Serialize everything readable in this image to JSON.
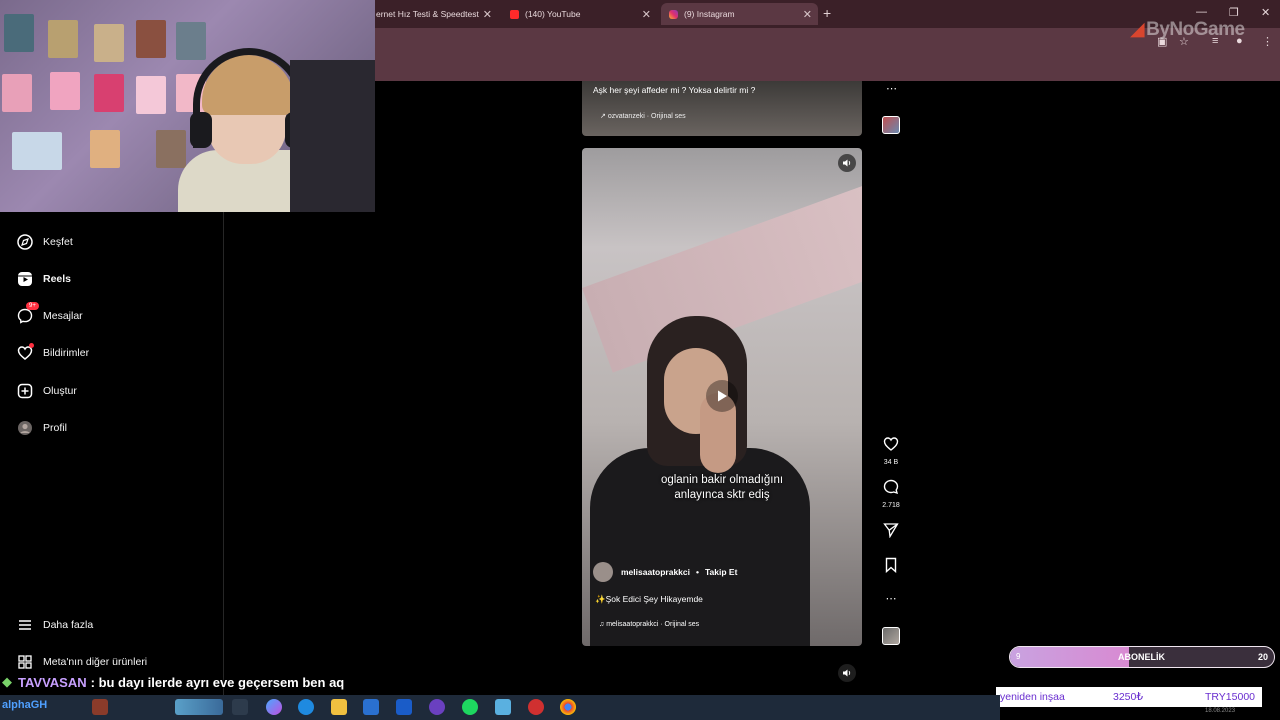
{
  "browser": {
    "tabs": [
      {
        "label": "ernet Hız Testi & Speedtest",
        "active": false
      },
      {
        "label": "(140) YouTube",
        "active": false
      },
      {
        "label": "(9) Instagram",
        "active": true
      }
    ],
    "new_tab": "+",
    "min": "—",
    "max": "❐",
    "close": "✕"
  },
  "watermark": {
    "text": "ByNoGame"
  },
  "sidebar": {
    "items": [
      {
        "label": "Keşfet",
        "icon": "compass-icon"
      },
      {
        "label": "Reels",
        "icon": "reels-icon"
      },
      {
        "label": "Mesajlar",
        "icon": "messenger-icon",
        "badge": "9+"
      },
      {
        "label": "Bildirimler",
        "icon": "heart-icon"
      },
      {
        "label": "Oluştur",
        "icon": "plus-square-icon"
      },
      {
        "label": "Profil",
        "icon": "avatar-icon"
      }
    ],
    "more": "Daha fazla",
    "meta": "Meta'nın diğer ürünleri"
  },
  "reel_top": {
    "caption": "Aşk her şeyi affeder mi ? Yoksa delirtir mi ?",
    "audio": "ozvatanzeki · Orijinal ses"
  },
  "reel_main": {
    "subtitle_line1": "oglanin bakir olmadığını",
    "subtitle_line2": "anlayınca sktr ediş",
    "author": "melisaatoprakkci",
    "separator": "•",
    "follow": "Takip Et",
    "caption": "✨Şok Edici Şey Hikayemde",
    "audio": "melisaatoprakkci · Orijinal ses"
  },
  "actions": {
    "likes": "34 B",
    "comments": "2.718"
  },
  "chat": {
    "user": "TAVVASAN",
    "message": ": bu dayı ilerde ayrı eve geçersem ben aq"
  },
  "subgoal": {
    "left": "9",
    "label": "ABONELİK",
    "right": "20",
    "progress": 0.45
  },
  "goal": {
    "label": "yeniden inşaa",
    "current": "3250₺",
    "target": "TRY15000"
  },
  "taskbar": {
    "user": "alphaGH"
  },
  "clock": {
    "date": "18.08.2023"
  },
  "colors": {
    "accent": "#5b3843",
    "notification": "#ff3040"
  }
}
